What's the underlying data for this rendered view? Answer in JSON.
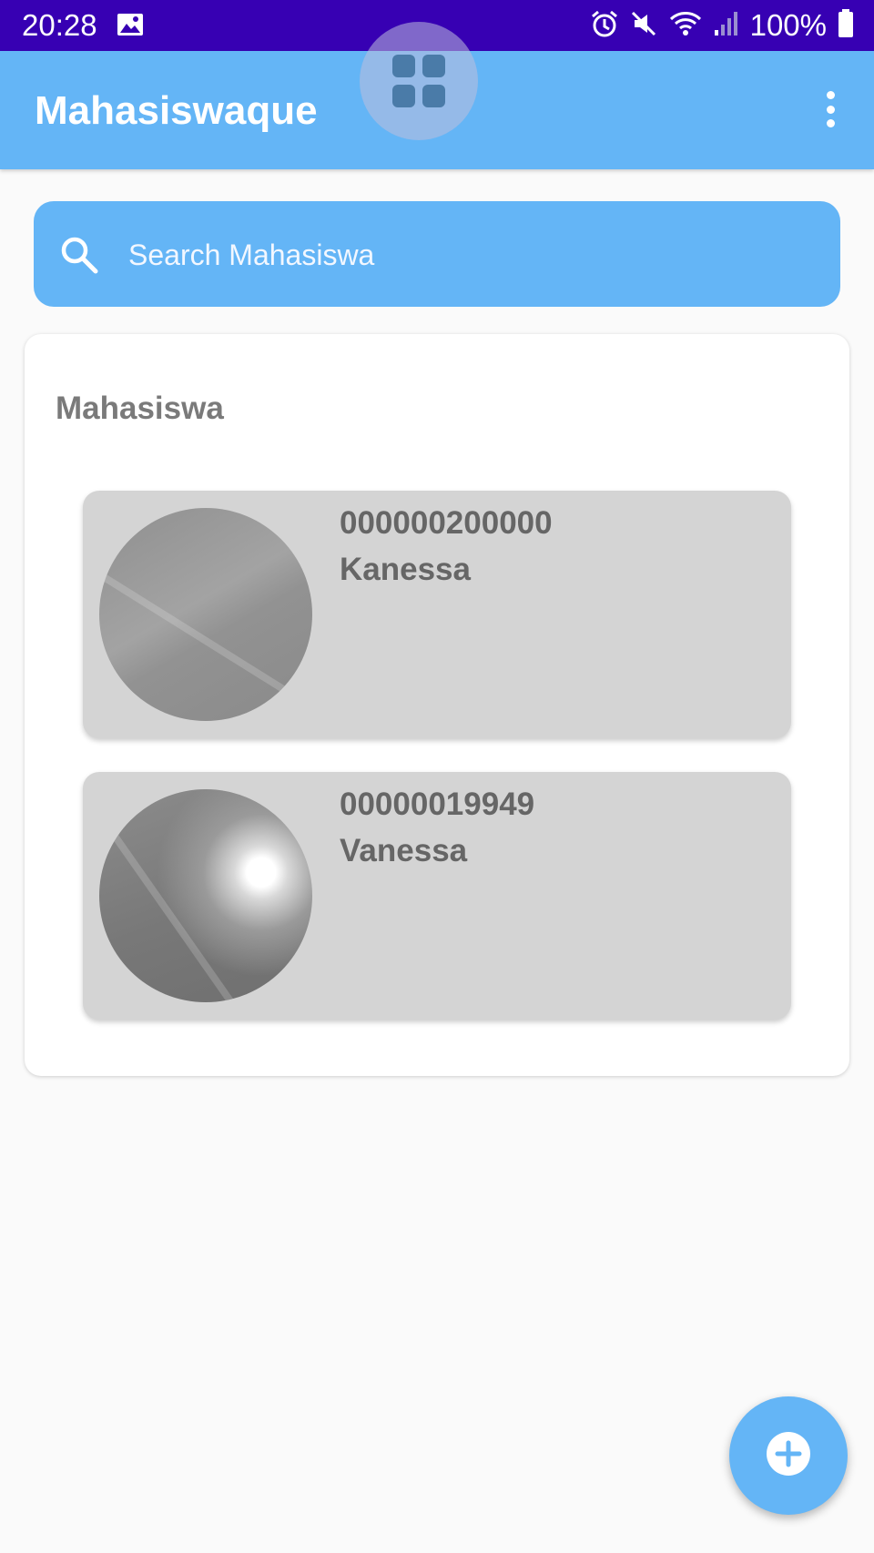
{
  "status_bar": {
    "time": "20:28",
    "battery": "100%",
    "icons": [
      "gallery-icon",
      "alarm-icon",
      "mute-icon",
      "wifi-icon",
      "signal-icon",
      "battery-icon"
    ]
  },
  "app_bar": {
    "title": "Mahasiswaque",
    "floating_icon": "grid-icon",
    "menu_icon": "overflow-menu-icon"
  },
  "search": {
    "placeholder": "Search Mahasiswa",
    "icon": "search-icon"
  },
  "section": {
    "title": "Mahasiswa"
  },
  "students": [
    {
      "nim": "000000200000",
      "name": "Kanessa"
    },
    {
      "nim": "00000019949",
      "name": "Vanessa"
    }
  ],
  "fab": {
    "icon": "add-circle-icon"
  },
  "colors": {
    "status_bar": "#3700b3",
    "primary": "#64b5f6",
    "card_item": "#d4d4d4",
    "text_secondary": "#666666"
  }
}
